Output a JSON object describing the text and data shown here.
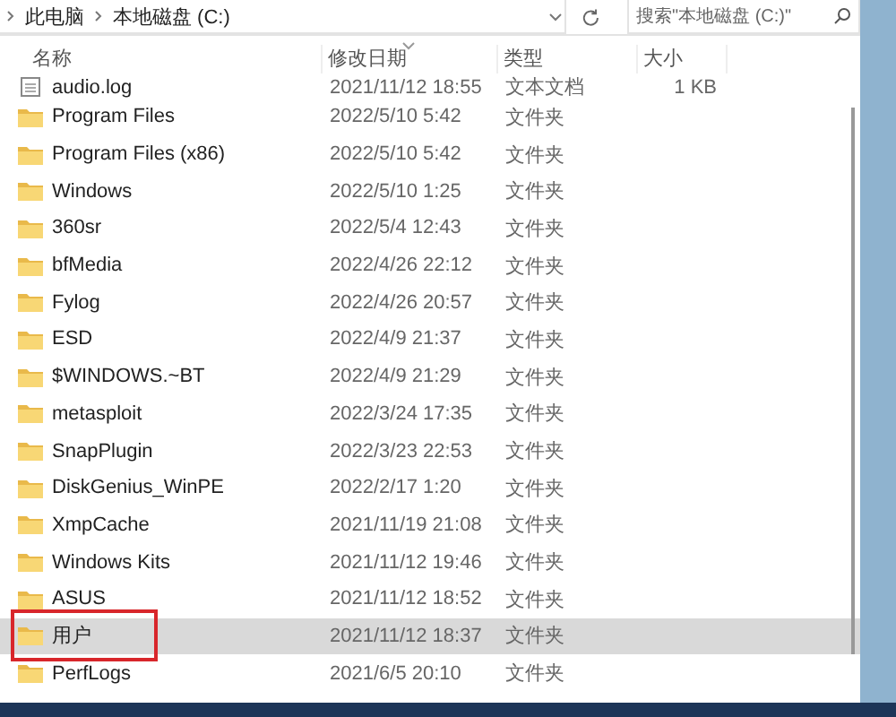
{
  "breadcrumb": [
    "此电脑",
    "本地磁盘 (C:)"
  ],
  "search": {
    "placeholder": "搜索\"本地磁盘 (C:)\""
  },
  "columns": [
    "名称",
    "修改日期",
    "类型",
    "大小"
  ],
  "rows": [
    {
      "kind": "file",
      "name": "audio.log",
      "date": "2021/11/12 18:55",
      "type": "文本文档",
      "size": "1 KB",
      "selected": false
    },
    {
      "kind": "folder",
      "name": "Program Files",
      "date": "2022/5/10 5:42",
      "type": "文件夹",
      "selected": false
    },
    {
      "kind": "folder",
      "name": "Program Files (x86)",
      "date": "2022/5/10 5:42",
      "type": "文件夹",
      "selected": false
    },
    {
      "kind": "folder",
      "name": "Windows",
      "date": "2022/5/10 1:25",
      "type": "文件夹",
      "selected": false
    },
    {
      "kind": "folder",
      "name": "360sr",
      "date": "2022/5/4 12:43",
      "type": "文件夹",
      "selected": false
    },
    {
      "kind": "folder",
      "name": "bfMedia",
      "date": "2022/4/26 22:12",
      "type": "文件夹",
      "selected": false
    },
    {
      "kind": "folder",
      "name": "Fylog",
      "date": "2022/4/26 20:57",
      "type": "文件夹",
      "selected": false
    },
    {
      "kind": "folder",
      "name": "ESD",
      "date": "2022/4/9 21:37",
      "type": "文件夹",
      "selected": false
    },
    {
      "kind": "folder",
      "name": "$WINDOWS.~BT",
      "date": "2022/4/9 21:29",
      "type": "文件夹",
      "selected": false
    },
    {
      "kind": "folder",
      "name": "metasploit",
      "date": "2022/3/24 17:35",
      "type": "文件夹",
      "selected": false
    },
    {
      "kind": "folder",
      "name": "SnapPlugin",
      "date": "2022/3/23 22:53",
      "type": "文件夹",
      "selected": false
    },
    {
      "kind": "folder",
      "name": "DiskGenius_WinPE",
      "date": "2022/2/17 1:20",
      "type": "文件夹",
      "selected": false
    },
    {
      "kind": "folder",
      "name": "XmpCache",
      "date": "2021/11/19 21:08",
      "type": "文件夹",
      "selected": false
    },
    {
      "kind": "folder",
      "name": "Windows Kits",
      "date": "2021/11/12 19:46",
      "type": "文件夹",
      "selected": false
    },
    {
      "kind": "folder",
      "name": "ASUS",
      "date": "2021/11/12 18:52",
      "type": "文件夹",
      "selected": false
    },
    {
      "kind": "folder",
      "name": "用户",
      "date": "2021/11/12 18:37",
      "type": "文件夹",
      "selected": true
    },
    {
      "kind": "folder",
      "name": "PerfLogs",
      "date": "2021/6/5 20:10",
      "type": "文件夹",
      "selected": false
    }
  ]
}
